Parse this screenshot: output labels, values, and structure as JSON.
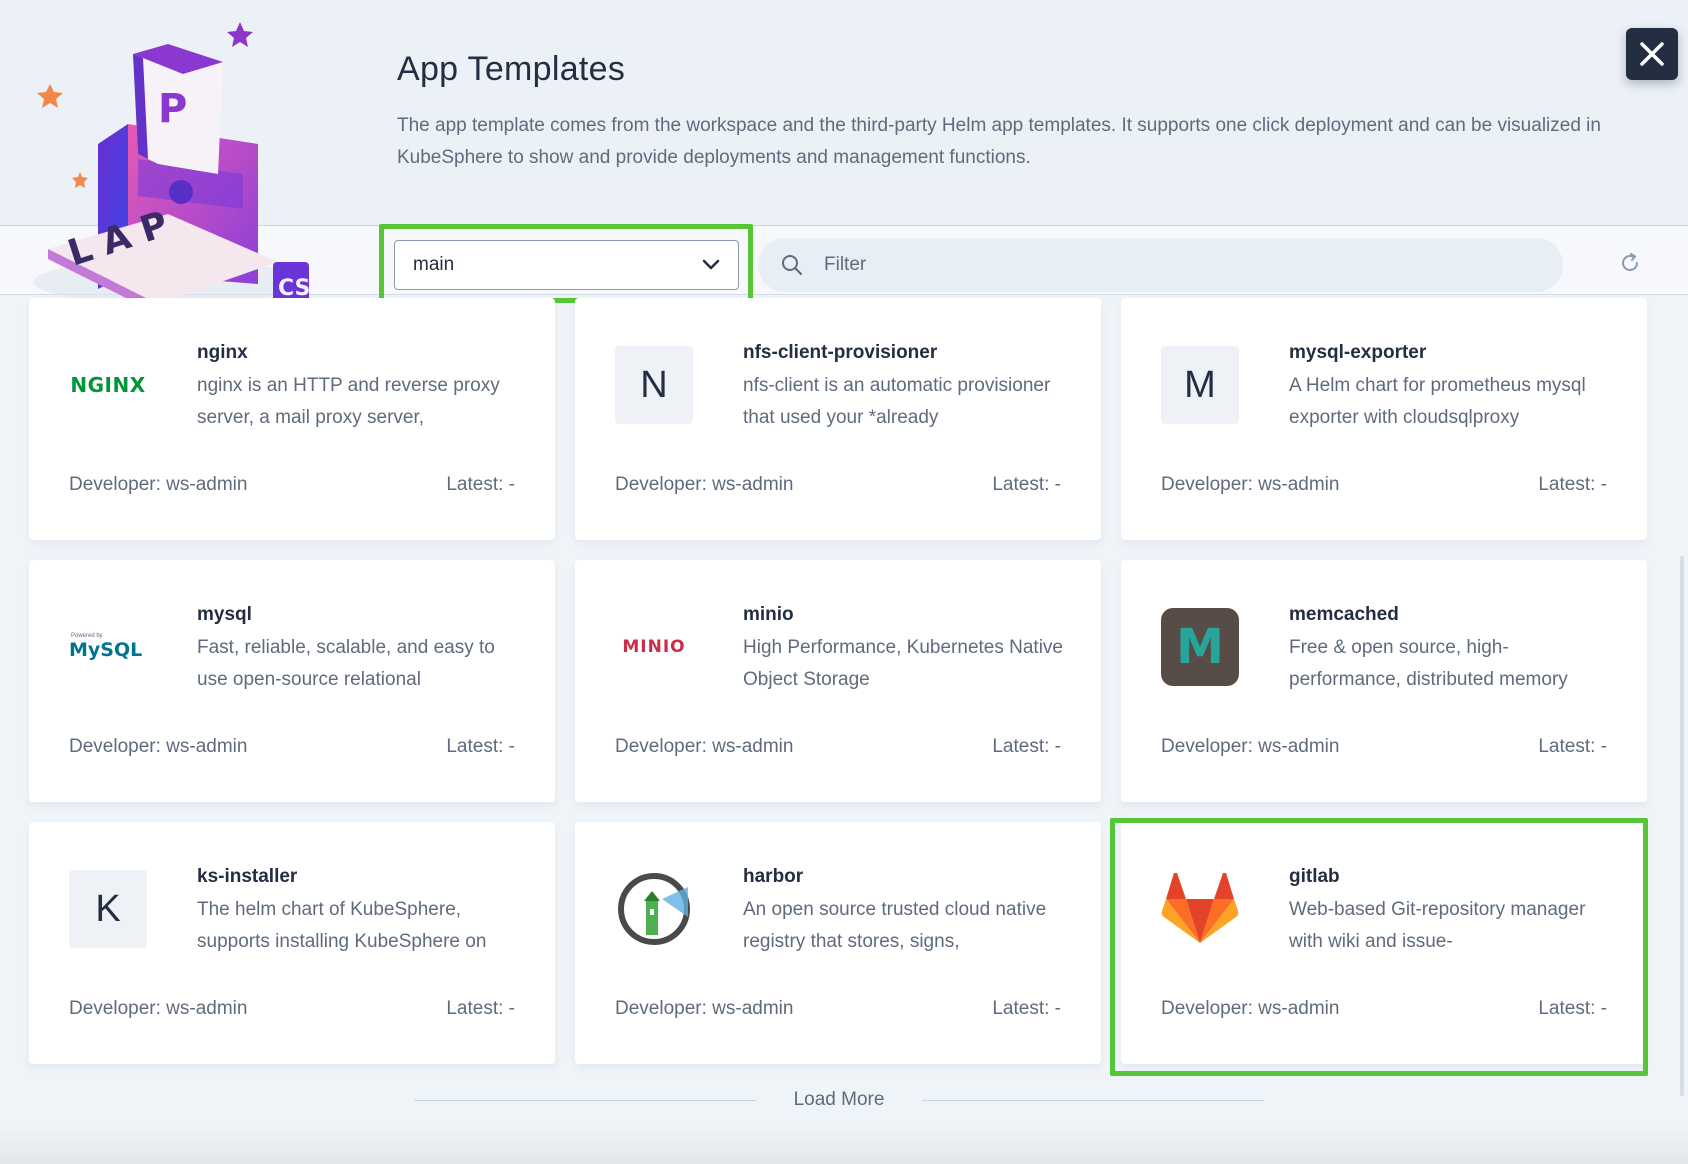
{
  "header": {
    "title": "App Templates",
    "description": "The app template comes from the workspace and the third-party Helm app templates. It supports one click deployment and can be visualized in KubeSphere to show and provide deployments and management functions."
  },
  "toolbar": {
    "repo_select_value": "main",
    "search_placeholder": "Filter"
  },
  "apps": [
    {
      "name": "nginx",
      "description": "nginx is an HTTP and reverse proxy server, a mail proxy server,",
      "developer": "Developer: ws-admin",
      "latest": "Latest: -",
      "icon": "nginx-logo",
      "logo_text": "NGINX"
    },
    {
      "name": "nfs-client-provisioner",
      "description": "nfs-client is an automatic provisioner that used your *already",
      "developer": "Developer: ws-admin",
      "latest": "Latest: -",
      "icon": "letter-icon",
      "letter": "N"
    },
    {
      "name": "mysql-exporter",
      "description": "A Helm chart for prometheus mysql exporter with cloudsqlproxy",
      "developer": "Developer: ws-admin",
      "latest": "Latest: -",
      "icon": "letter-icon",
      "letter": "M"
    },
    {
      "name": "mysql",
      "description": "Fast, reliable, scalable, and easy to use open-source relational",
      "developer": "Developer: ws-admin",
      "latest": "Latest: -",
      "icon": "mysql-logo",
      "logo_text": "MySQL",
      "logo_subtext": "Powered by"
    },
    {
      "name": "minio",
      "description": "High Performance, Kubernetes Native Object Storage",
      "developer": "Developer: ws-admin",
      "latest": "Latest: -",
      "icon": "minio-logo",
      "logo_text": "MINIO"
    },
    {
      "name": "memcached",
      "description": "Free & open source, high-performance, distributed memory",
      "developer": "Developer: ws-admin",
      "latest": "Latest: -",
      "icon": "memcached-logo",
      "logo_text": "M"
    },
    {
      "name": "ks-installer",
      "description": "The helm chart of KubeSphere, supports installing KubeSphere on",
      "developer": "Developer: ws-admin",
      "latest": "Latest: -",
      "icon": "letter-icon",
      "letter": "K"
    },
    {
      "name": "harbor",
      "description": "An open source trusted cloud native registry that stores, signs,",
      "developer": "Developer: ws-admin",
      "latest": "Latest: -",
      "icon": "harbor-logo"
    },
    {
      "name": "gitlab",
      "description": "Web-based Git-repository manager with wiki and issue-",
      "developer": "Developer: ws-admin",
      "latest": "Latest: -",
      "icon": "gitlab-logo"
    }
  ],
  "load_more": "Load More",
  "hero_art": {
    "icon": "app-store-illustration",
    "letters": "LAP",
    "badge": "CS"
  },
  "colors": {
    "highlight": "#55c737",
    "dark": "#242e42",
    "muted": "#5f6b7d",
    "nginx": "#009639",
    "minio": "#c72e49",
    "gitlab": "#fc6d26"
  }
}
